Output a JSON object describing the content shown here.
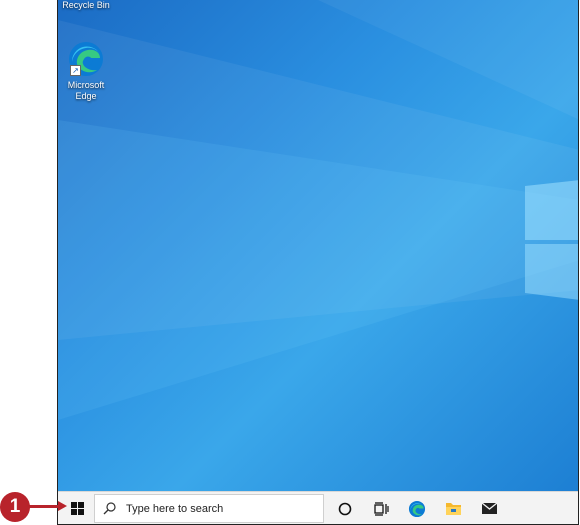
{
  "desktop": {
    "icons": [
      {
        "label": "Recycle Bin",
        "icon": "recycle-bin-icon"
      },
      {
        "label": "Microsoft Edge",
        "icon": "edge-icon"
      }
    ]
  },
  "taskbar": {
    "start_icon": "windows-logo-icon",
    "search_placeholder": "Type here to search",
    "pinned": [
      "cortana-icon",
      "task-view-icon",
      "edge-icon",
      "file-explorer-icon",
      "mail-icon"
    ]
  },
  "annotation": {
    "callout_number": "1",
    "color": "#b8232b"
  },
  "colors": {
    "desktop_blue": "#2a8fe0",
    "taskbar_bg": "#f3f3f3"
  }
}
